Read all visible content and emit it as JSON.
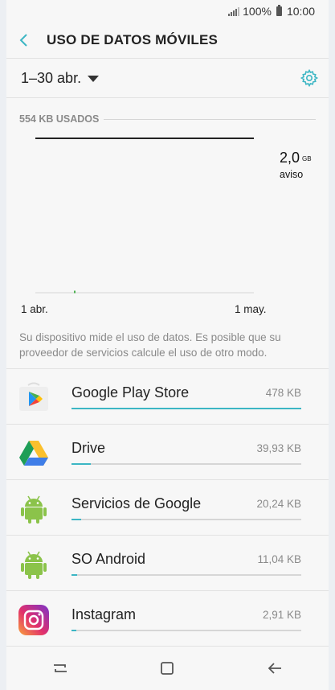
{
  "status_bar": {
    "battery": "100%",
    "time": "10:00"
  },
  "app_bar": {
    "title": "USO DE DATOS MÓVILES",
    "back_icon": "chevron-left-icon"
  },
  "period": {
    "label": "1–30 abr.",
    "settings_icon": "gear-icon"
  },
  "chart_data": {
    "type": "line",
    "used_label": "554 KB USADOS",
    "limit_value": "2,0",
    "limit_unit": "GB",
    "limit_caption": "aviso",
    "x_start_label": "1 abr.",
    "x_end_label": "1 may.",
    "usage_points_kb": [
      554
    ],
    "colors": {
      "limit_line": "#222222",
      "usage": "#4caf50",
      "baseline": "#cfcfcf"
    }
  },
  "disclaimer": "Su dispositivo mide el uso de datos. Es posible que su proveedor de servicios calcule el uso de otro modo.",
  "apps": [
    {
      "name": "Google Play Store",
      "size": "478 KB",
      "fraction": 1.0,
      "icon": "play-store-icon"
    },
    {
      "name": "Drive",
      "size": "39,93 KB",
      "fraction": 0.083,
      "icon": "drive-icon"
    },
    {
      "name": "Servicios de Google",
      "size": "20,24 KB",
      "fraction": 0.042,
      "icon": "android-icon"
    },
    {
      "name": "SO Android",
      "size": "11,04 KB",
      "fraction": 0.023,
      "icon": "android-icon"
    },
    {
      "name": "Instagram",
      "size": "2,91 KB",
      "fraction": 0.006,
      "icon": "instagram-icon"
    }
  ],
  "accent_color": "#3cb6c4"
}
